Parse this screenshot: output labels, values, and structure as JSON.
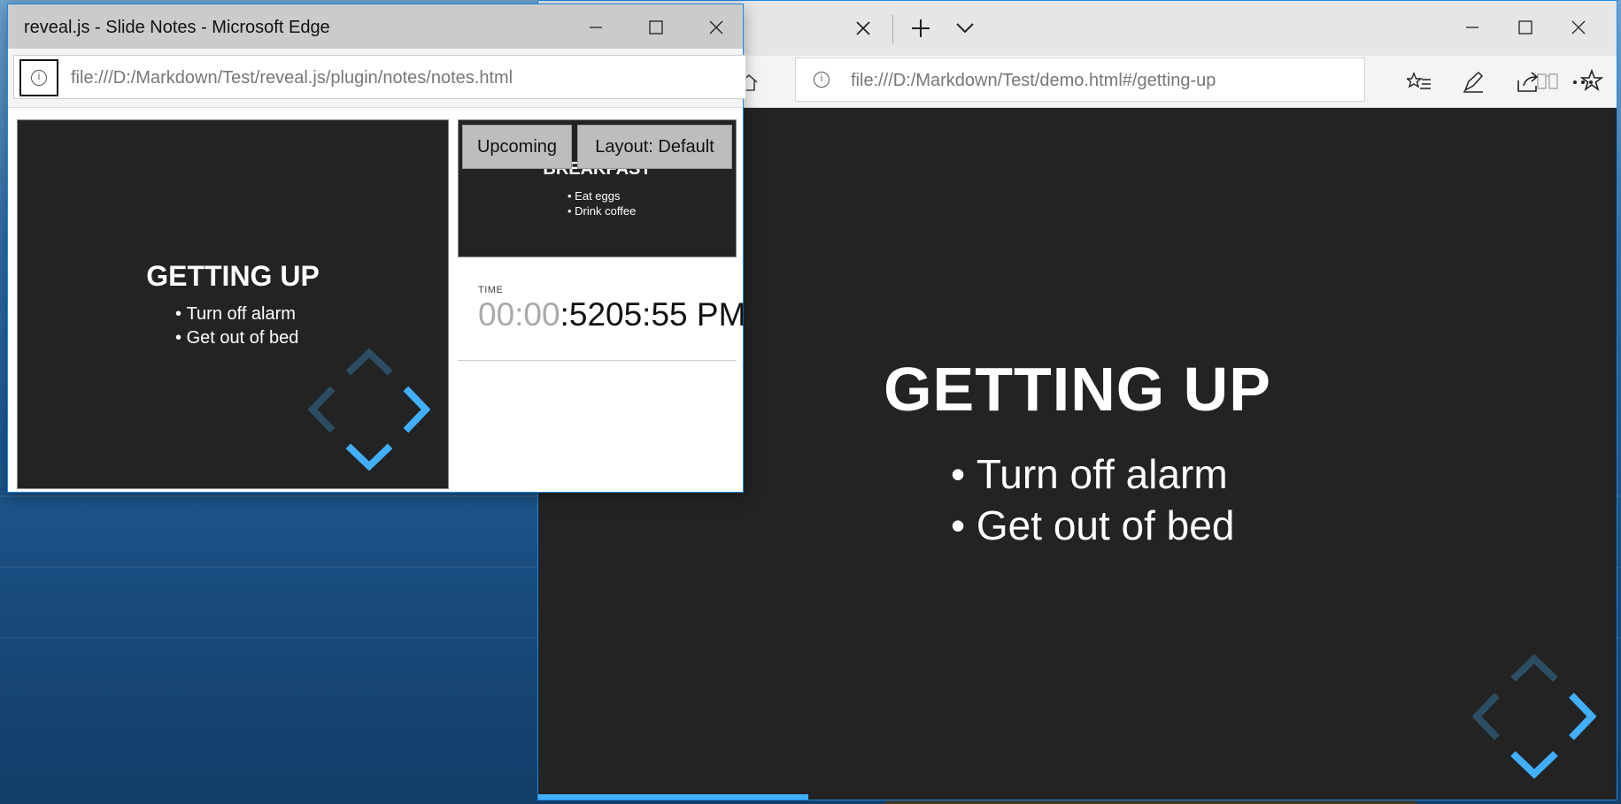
{
  "main_window": {
    "tab_close_icon": "close-icon",
    "new_tab_icon": "plus-icon",
    "tab_list_icon": "chevron-down-icon",
    "address": "file:///D:/Markdown/Test/demo.html#/getting-up",
    "slide": {
      "title": "GETTING UP",
      "bullets": [
        "Turn off alarm",
        "Get out of bed"
      ]
    },
    "progress": 0.25
  },
  "notes_window": {
    "title": "reveal.js - Slide Notes - Microsoft Edge",
    "address": "file:///D:/Markdown/Test/reveal.js/plugin/notes/notes.html",
    "current_slide": {
      "title": "GETTING UP",
      "bullets": [
        "Turn off alarm",
        "Get out of bed"
      ]
    },
    "upcoming_slide": {
      "title": "BREAKFAST",
      "bullets": [
        "Eat eggs",
        "Drink coffee"
      ]
    },
    "buttons": {
      "upcoming": "Upcoming",
      "layout": "Layout: Default"
    },
    "time": {
      "label": "TIME",
      "timer_dim": "00:00",
      "timer_rest": ":52",
      "clock": "05:55 PM"
    }
  },
  "colors": {
    "slide_bg": "#232323",
    "accent": "#42affa",
    "window_border": "#1e88e5"
  }
}
